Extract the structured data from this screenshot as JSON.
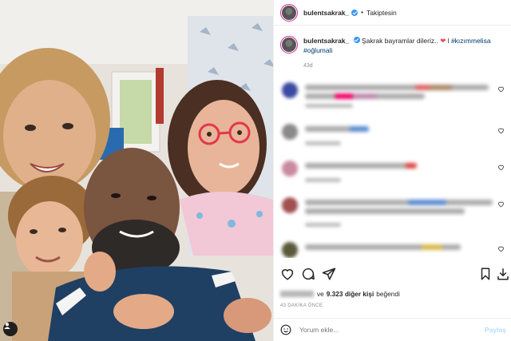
{
  "post": {
    "username": "bulentsakrak_",
    "follow_status": "Takiptesin",
    "separator": "•"
  },
  "caption": {
    "username": "bulentsakrak_",
    "text": "Şakrak bayramlar dileriz..",
    "heart": "❤",
    "text_after": "l",
    "hashtag1": "#kızımmelisa",
    "hashtag2": "#oğlumali",
    "time": "43d"
  },
  "likes": {
    "connector": "ve",
    "count": "9.323 diğer kişi",
    "suffix": "beğendi"
  },
  "posted_ago": "43 DAKİKA ÖNCE",
  "composer": {
    "placeholder": "Yorum ekle...",
    "post_label": "Paylaş"
  },
  "icons": [
    "verified-badge-icon",
    "heart-icon",
    "comment-icon",
    "share-icon",
    "bookmark-icon",
    "emoji-icon",
    "user-tag-icon",
    "more-icon"
  ],
  "colors": {
    "hashtag": "#00376b",
    "verified": "#3897f0",
    "post_button_disabled": "#b2dffc",
    "story_ring": "#d6249f"
  }
}
